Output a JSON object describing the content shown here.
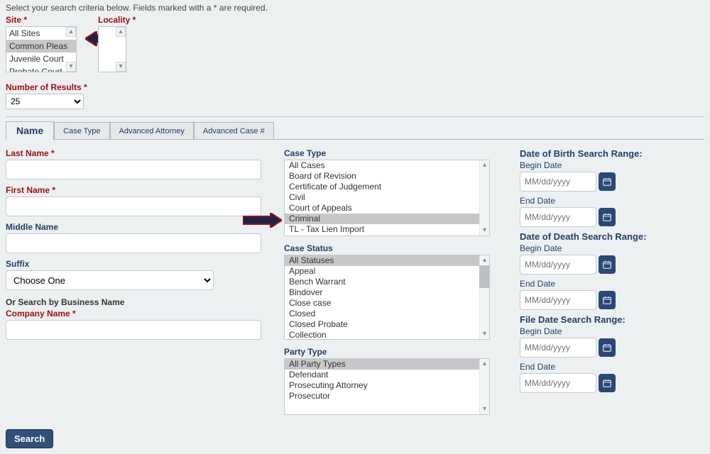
{
  "instruction": "Select your search criteria below. Fields marked with a * are required.",
  "top": {
    "site_label": "Site *",
    "locality_label": "Locality *",
    "site_options": [
      "All Sites",
      "Common Pleas",
      "Juvenile Court",
      "Probate Court"
    ],
    "site_selected_index": 1,
    "num_results_label": "Number of Results *",
    "num_results_value": "25"
  },
  "tabs": {
    "items": [
      "Name",
      "Case Type",
      "Advanced Attorney",
      "Advanced Case #"
    ],
    "active_index": 0
  },
  "nameform": {
    "last_name_label": "Last Name *",
    "first_name_label": "First Name *",
    "middle_name_label": "Middle Name",
    "suffix_label": "Suffix",
    "suffix_placeholder": "Choose One",
    "or_label": "Or Search by Business Name",
    "company_label": "Company Name *"
  },
  "casetype": {
    "label": "Case Type",
    "options": [
      "All Cases",
      "Board of Revision",
      "Certificate of Judgement",
      "Civil",
      "Court of Appeals",
      "Criminal",
      "TL - Tax Lien Import"
    ],
    "highlight_index": 5
  },
  "casestatus": {
    "label": "Case Status",
    "options": [
      "All Statuses",
      "Appeal",
      "Bench Warrant",
      "Bindover",
      "Close case",
      "Closed",
      "Closed Probate",
      "Collection"
    ],
    "highlight_index": 0
  },
  "partytype": {
    "label": "Party Type",
    "options": [
      "All Party Types",
      "Defendant",
      "Prosecuting Attorney",
      "Prosecutor"
    ],
    "highlight_index": 0
  },
  "dates": {
    "dob_title": "Date of Birth Search Range:",
    "dod_title": "Date of Death Search Range:",
    "file_title": "File Date Search Range:",
    "begin_label": "Begin Date",
    "end_label": "End Date",
    "placeholder": "MM/dd/yyyy"
  },
  "search_button": "Search"
}
